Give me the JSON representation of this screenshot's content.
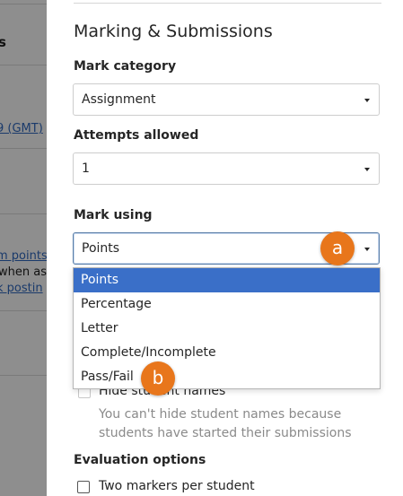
{
  "background": {
    "fragments": [
      "s",
      "9 (GMT)",
      "m points",
      "when as",
      "k postin"
    ]
  },
  "panel": {
    "section_title": "Marking & Submissions",
    "mark_category": {
      "label": "Mark category",
      "value": "Assignment"
    },
    "attempts_allowed": {
      "label": "Attempts allowed",
      "value": "1"
    },
    "mark_using": {
      "label": "Mark using",
      "value": "Points",
      "options": [
        "Points",
        "Percentage",
        "Letter",
        "Complete/Incomplete",
        "Pass/Fail"
      ]
    },
    "hide_student_names": {
      "label": "Hide student names",
      "helper": "You can't hide student names because students have started their submissions"
    },
    "evaluation_options": {
      "label": "Evaluation options",
      "two_markers": "Two markers per student"
    }
  },
  "callouts": {
    "a": "a",
    "b": "b"
  },
  "colors": {
    "callout": "#e8761b",
    "selected_option": "#3a6fc8"
  }
}
